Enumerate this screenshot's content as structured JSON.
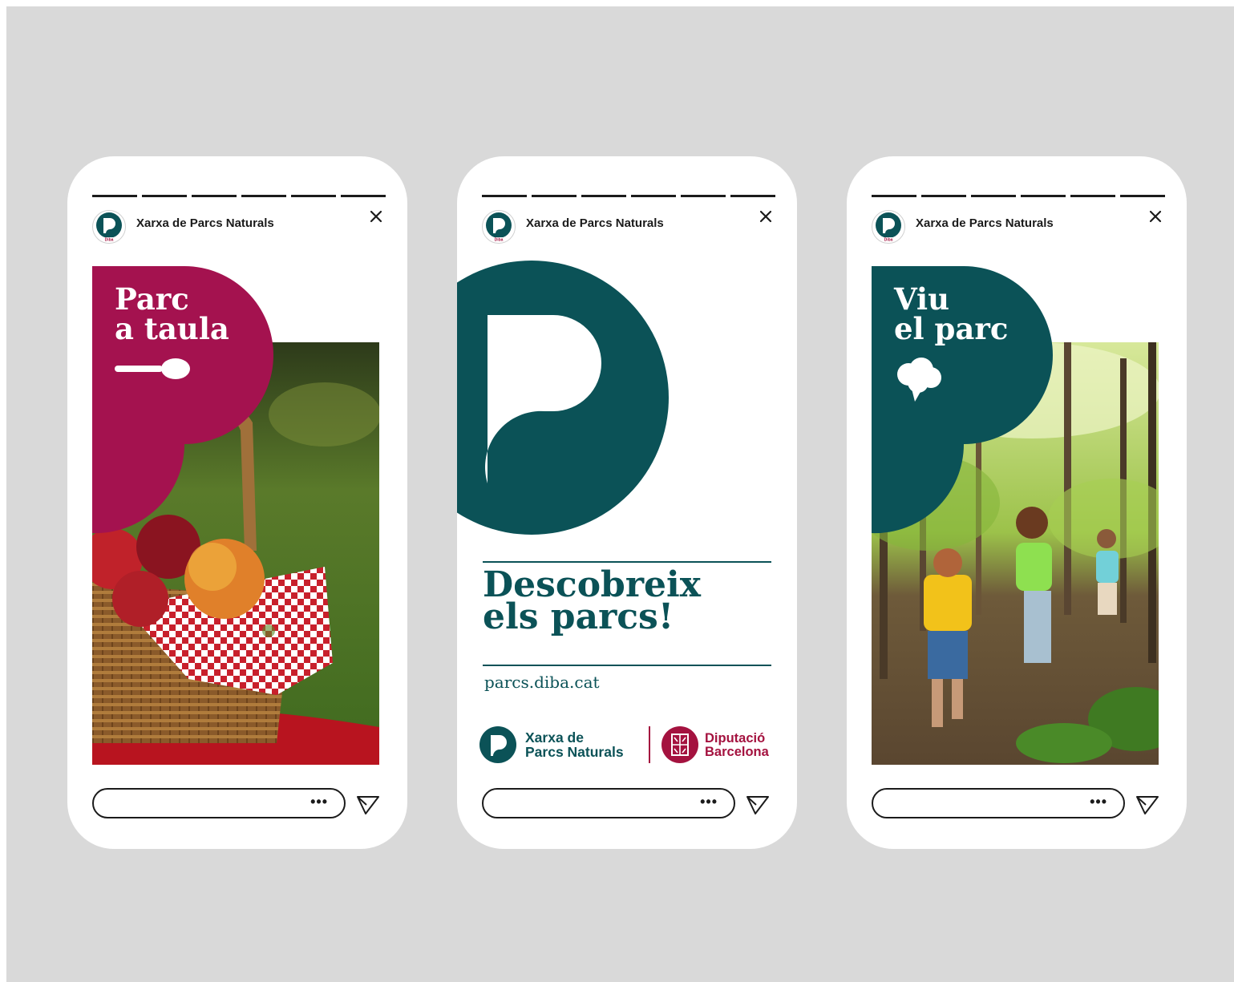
{
  "colors": {
    "background": "#d9d9d9",
    "brand_green": "#0b5257",
    "brand_magenta": "#a4124f",
    "diputacio_red": "#a4123f",
    "ink": "#1b1b1b"
  },
  "stories": [
    {
      "account_name": "Xarxa de Parcs Naturals",
      "avatar_badge": "Diba",
      "headline": "Parc\na taula",
      "headline_icon": "spoon-icon",
      "photo_subject": "picnic basket with apples on checkered cloth",
      "reply_more": "•••",
      "progress_segments": 6
    },
    {
      "account_name": "Xarxa de Parcs Naturals",
      "avatar_badge": "Diba",
      "cta": "Descobreix\nels parcs!",
      "url": "parcs.diba.cat",
      "logo_primary": "Xarxa de\nParcs Naturals",
      "logo_secondary": "Diputació\nBarcelona",
      "reply_more": "•••",
      "progress_segments": 6
    },
    {
      "account_name": "Xarxa de Parcs Naturals",
      "avatar_badge": "Diba",
      "headline": "Viu\nel parc",
      "headline_icon": "speech-cloud-icon",
      "photo_subject": "children running in a sunlit forest",
      "reply_more": "•••",
      "progress_segments": 6
    }
  ]
}
